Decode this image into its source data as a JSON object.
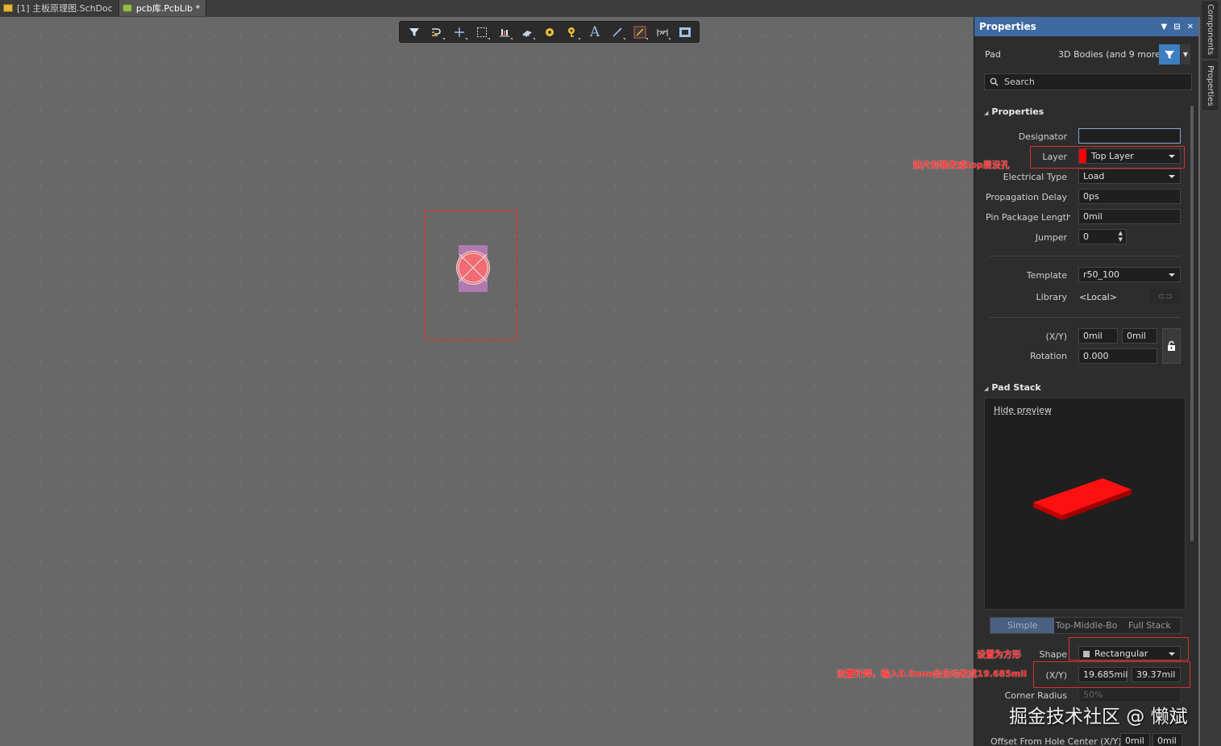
{
  "tabs": [
    {
      "label": "[1] 主板原理图.SchDoc",
      "icon": "schematic-doc-icon"
    },
    {
      "label": "pcb库.PcbLib *",
      "icon": "pcb-lib-icon"
    }
  ],
  "panel": {
    "title": "Properties",
    "object_kind": "Pad",
    "filter_text": "3D Bodies (and 9 more)",
    "search_placeholder": "Search",
    "side_tabs": [
      "Components",
      "Properties"
    ],
    "properties_section": "Properties",
    "designator_label": "Designator",
    "designator_value": "",
    "layer_label": "Layer",
    "layer_value": "Top Layer",
    "layer_color": "#ff0000",
    "electrical_type_label": "Electrical Type",
    "electrical_type_value": "Load",
    "prop_delay_label": "Propagation Delay",
    "prop_delay_value": "0ps",
    "pin_pkg_label": "Pin Package Length",
    "pin_pkg_value": "0mil",
    "jumper_label": "Jumper",
    "jumper_value": "0",
    "template_label": "Template",
    "template_value": "r50_100",
    "library_label": "Library",
    "library_value": "<Local>",
    "xy_label": "(X/Y)",
    "x_value": "0mil",
    "y_value": "0mil",
    "rotation_label": "Rotation",
    "rotation_value": "0.000",
    "pad_stack_section": "Pad Stack",
    "hide_preview": "Hide preview",
    "stack_tabs": [
      "Simple",
      "Top-Middle-Bo",
      "Full Stack"
    ],
    "shape_label": "Shape",
    "shape_value": "Rectangular",
    "size_label": "(X/Y)",
    "size_x": "19.685mil",
    "size_y": "39.37mil",
    "corner_label": "Corner Radius",
    "corner_value": "50%",
    "offset_label": "Offset From Hole Center (X/Y)",
    "offset_x": "0mil",
    "offset_y": "0mil"
  },
  "annotations": {
    "layer_note": "贴片封装改成top层没孔",
    "shape_note": "设置为方形",
    "size_note": "设置钎焊，输入0.5mm会自动改成19.685mil"
  },
  "watermark": "掘金技术社区 @ 懒斌",
  "colors": {
    "accent": "#3e6aa0",
    "pad": "#f06b74",
    "annotation": "#e03030"
  }
}
